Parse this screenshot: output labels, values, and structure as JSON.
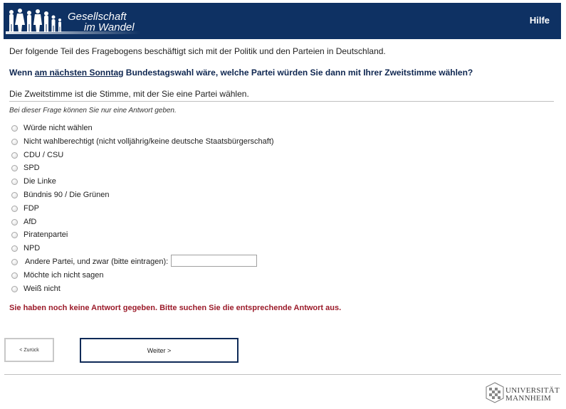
{
  "header": {
    "logo_line1": "Gesellschaft",
    "logo_line2": "im Wandel",
    "help_label": "Hilfe",
    "background_color": "#0e3163"
  },
  "intro": "Der folgende Teil des Fragebogens beschäftigt sich mit der Politik und den Parteien in Deutschland.",
  "question": {
    "prefix": "Wenn ",
    "underlined": "am nächsten Sonntag",
    "suffix": " Bundestagswahl wäre, welche Partei würden Sie dann mit Ihrer Zweitstimme wählen?"
  },
  "explain": "Die Zweitstimme ist die Stimme, mit der Sie eine Partei wählen.",
  "hint": "Bei dieser Frage können Sie nur eine Antwort geben.",
  "options": [
    "Würde nicht wählen",
    "Nicht wahlberechtigt (nicht volljährig/keine deutsche Staatsbürgerschaft)",
    "CDU / CSU",
    "SPD",
    "Die Linke",
    "Bündnis 90 / Die Grünen",
    "FDP",
    "AfD",
    "Piratenpartei",
    "NPD",
    "Andere Partei, und zwar (bitte eintragen):",
    "Möchte ich nicht sagen",
    "Weiß nicht"
  ],
  "other_party_value": "",
  "error": "Sie haben noch keine Antwort gegeben. Bitte suchen Sie die entsprechende Antwort aus.",
  "error_color": "#9b1b2a",
  "nav": {
    "back_label": "< Zurück",
    "next_label": "Weiter >"
  },
  "footer": {
    "uni_line1": "UNIVERSITÄT",
    "uni_line2": "MANNHEIM"
  }
}
